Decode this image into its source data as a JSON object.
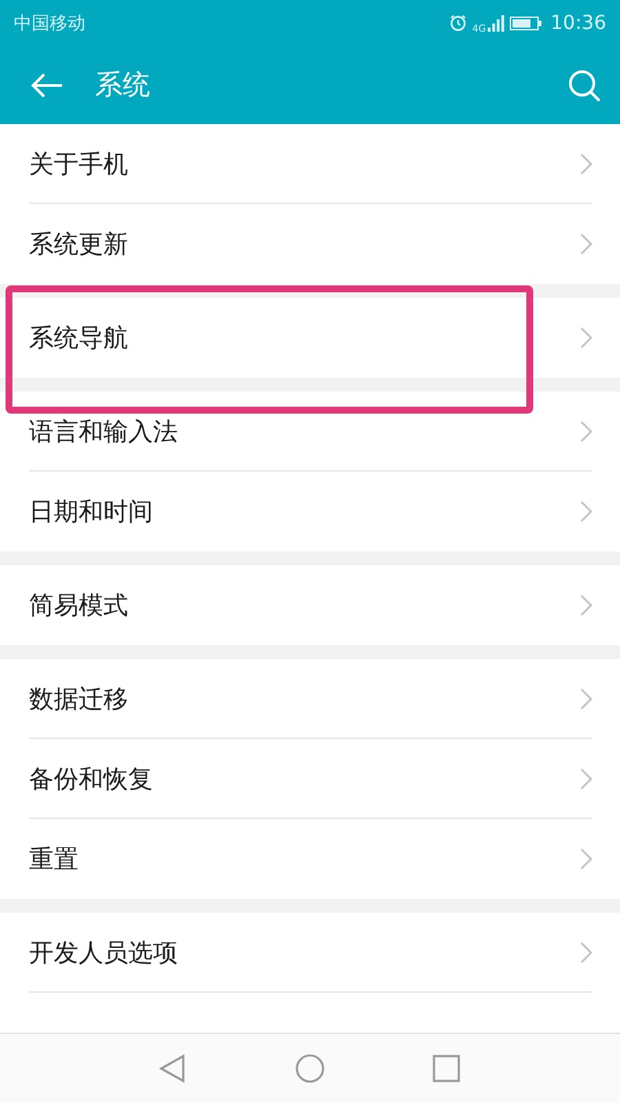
{
  "status_bar": {
    "carrier": "中国移动",
    "network": "4G",
    "time": "10:36"
  },
  "header": {
    "title": "系统"
  },
  "groups": [
    {
      "items": [
        {
          "label": "关于手机",
          "highlighted": false
        },
        {
          "label": "系统更新",
          "highlighted": false
        }
      ]
    },
    {
      "items": [
        {
          "label": "系统导航",
          "highlighted": true
        }
      ]
    },
    {
      "items": [
        {
          "label": "语言和输入法",
          "highlighted": false
        },
        {
          "label": "日期和时间",
          "highlighted": false
        }
      ]
    },
    {
      "items": [
        {
          "label": "简易模式",
          "highlighted": false
        }
      ]
    },
    {
      "items": [
        {
          "label": "数据迁移",
          "highlighted": false
        },
        {
          "label": "备份和恢复",
          "highlighted": false
        },
        {
          "label": "重置",
          "highlighted": false
        }
      ]
    },
    {
      "items": [
        {
          "label": "开发人员选项",
          "highlighted": false
        }
      ]
    }
  ]
}
